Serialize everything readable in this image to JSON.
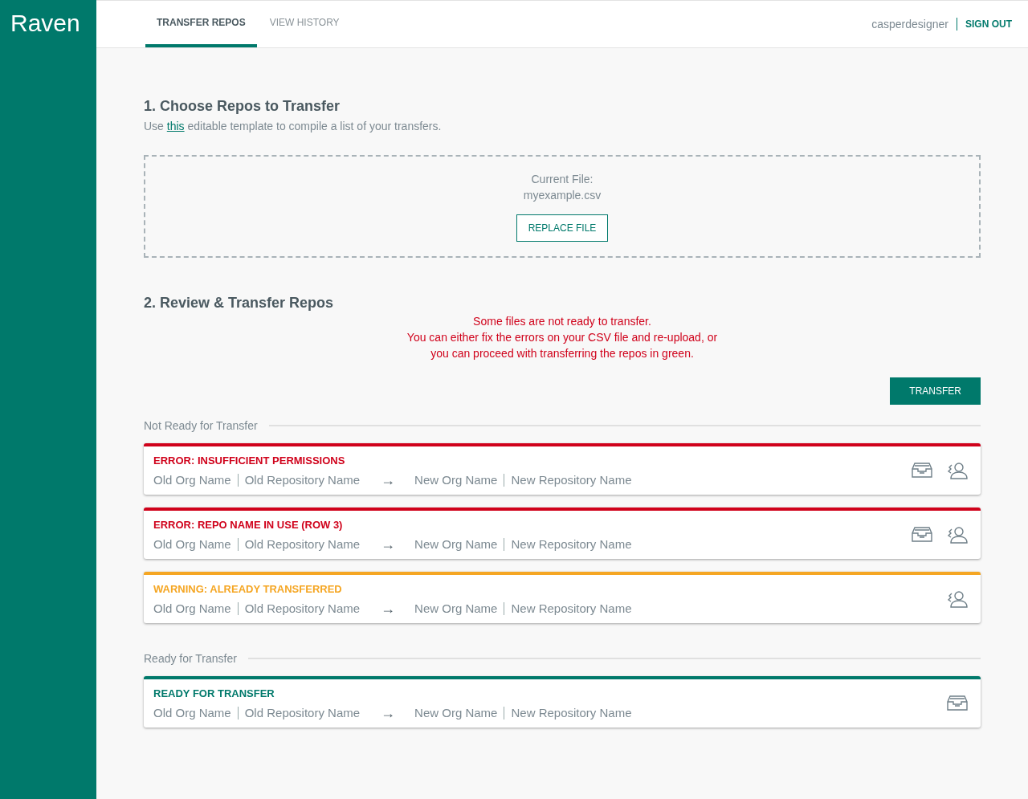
{
  "brand": "Raven",
  "tabs": [
    {
      "label": "TRANSFER REPOS",
      "selected": true
    },
    {
      "label": "VIEW HISTORY",
      "selected": false
    }
  ],
  "user": {
    "name": "casperdesigner",
    "sign_out": "SIGN OUT"
  },
  "step1": {
    "title": "1. Choose Repos to Transfer",
    "intro_before": "Use",
    "intro_link": "this",
    "intro_after": "editable template to compile a list of your transfers.",
    "file_label": "Current File:",
    "file_name": "myexample.csv",
    "replace_button": "REPLACE FILE"
  },
  "step2": {
    "title": "2. Review & Transfer Repos",
    "message": [
      "Some files are not ready to transfer.",
      "You can either fix the errors on your CSV file and re-upload, or",
      "you can proceed with transferring the repos in green."
    ],
    "transfer_button": "TRANSFER"
  },
  "groups": [
    {
      "title": "Not Ready for Transfer",
      "cards": [
        {
          "kind": "error",
          "status": "ERROR: INSUFFICIENT PERMISSIONS",
          "old_org": "Old Org Name",
          "old_repo": "Old Repository Name",
          "arrow": "→",
          "new_org": "New Org Name",
          "new_repo": "New Repository Name",
          "inbox_icon": true,
          "person_icon": true
        },
        {
          "kind": "error",
          "status": "ERROR: REPO NAME IN USE (ROW 3)",
          "old_org": "Old Org Name",
          "old_repo": "Old Repository Name",
          "arrow": "→",
          "new_org": "New Org Name",
          "new_repo": "New Repository Name",
          "inbox_icon": true,
          "person_icon": true
        },
        {
          "kind": "warning",
          "status": "WARNING: ALREADY TRANSFERRED",
          "old_org": "Old Org Name",
          "old_repo": "Old Repository Name",
          "arrow": "→",
          "new_org": "New Org Name",
          "new_repo": "New Repository Name",
          "inbox_icon": false,
          "person_icon": true
        }
      ]
    },
    {
      "title": "Ready for Transfer",
      "cards": [
        {
          "kind": "ready",
          "status": "READY FOR TRANSFER",
          "old_org": "Old Org Name",
          "old_repo": "Old Repository Name",
          "arrow": "→",
          "new_org": "New Org Name",
          "new_repo": "New Repository Name",
          "inbox_icon": true,
          "person_icon": false
        }
      ]
    }
  ]
}
